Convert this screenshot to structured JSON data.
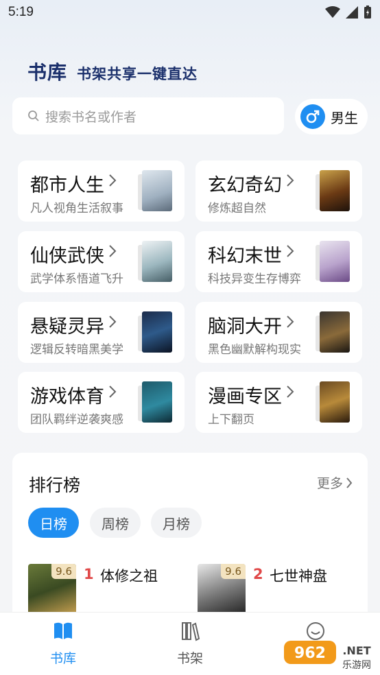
{
  "status_bar": {
    "time": "5:19"
  },
  "header": {
    "title": "书库",
    "slogan": "书架共享一键直达"
  },
  "search": {
    "placeholder": "搜索书名或作者"
  },
  "gender": {
    "label": "男生"
  },
  "categories": [
    {
      "title": "都市人生",
      "subtitle": "凡人视角生活叙事"
    },
    {
      "title": "玄幻奇幻",
      "subtitle": "修炼超自然"
    },
    {
      "title": "仙侠武侠",
      "subtitle": "武学体系悟道飞升"
    },
    {
      "title": "科幻末世",
      "subtitle": "科技异变生存博弈"
    },
    {
      "title": "悬疑灵异",
      "subtitle": "逻辑反转暗黑美学"
    },
    {
      "title": "脑洞大开",
      "subtitle": "黑色幽默解构现实"
    },
    {
      "title": "游戏体育",
      "subtitle": "团队羁绊逆袭爽感"
    },
    {
      "title": "漫画专区",
      "subtitle": "上下翻页"
    }
  ],
  "ranking": {
    "title": "排行榜",
    "more_label": "更多",
    "tabs": [
      "日榜",
      "周榜",
      "月榜"
    ],
    "active_tab": "日榜",
    "books": [
      {
        "rank": "1",
        "title": "体修之祖",
        "score": "9.6"
      },
      {
        "rank": "2",
        "title": "七世神盘",
        "score": "9.6"
      }
    ]
  },
  "bottom_nav": {
    "items": [
      "书库",
      "书架"
    ],
    "active": "书库"
  },
  "watermark": {
    "text": "962.NET",
    "sub": "乐游网"
  },
  "colors": {
    "accent": "#1f8ef1",
    "brand_dark": "#1a2f6b",
    "rank_red": "#e04848"
  }
}
